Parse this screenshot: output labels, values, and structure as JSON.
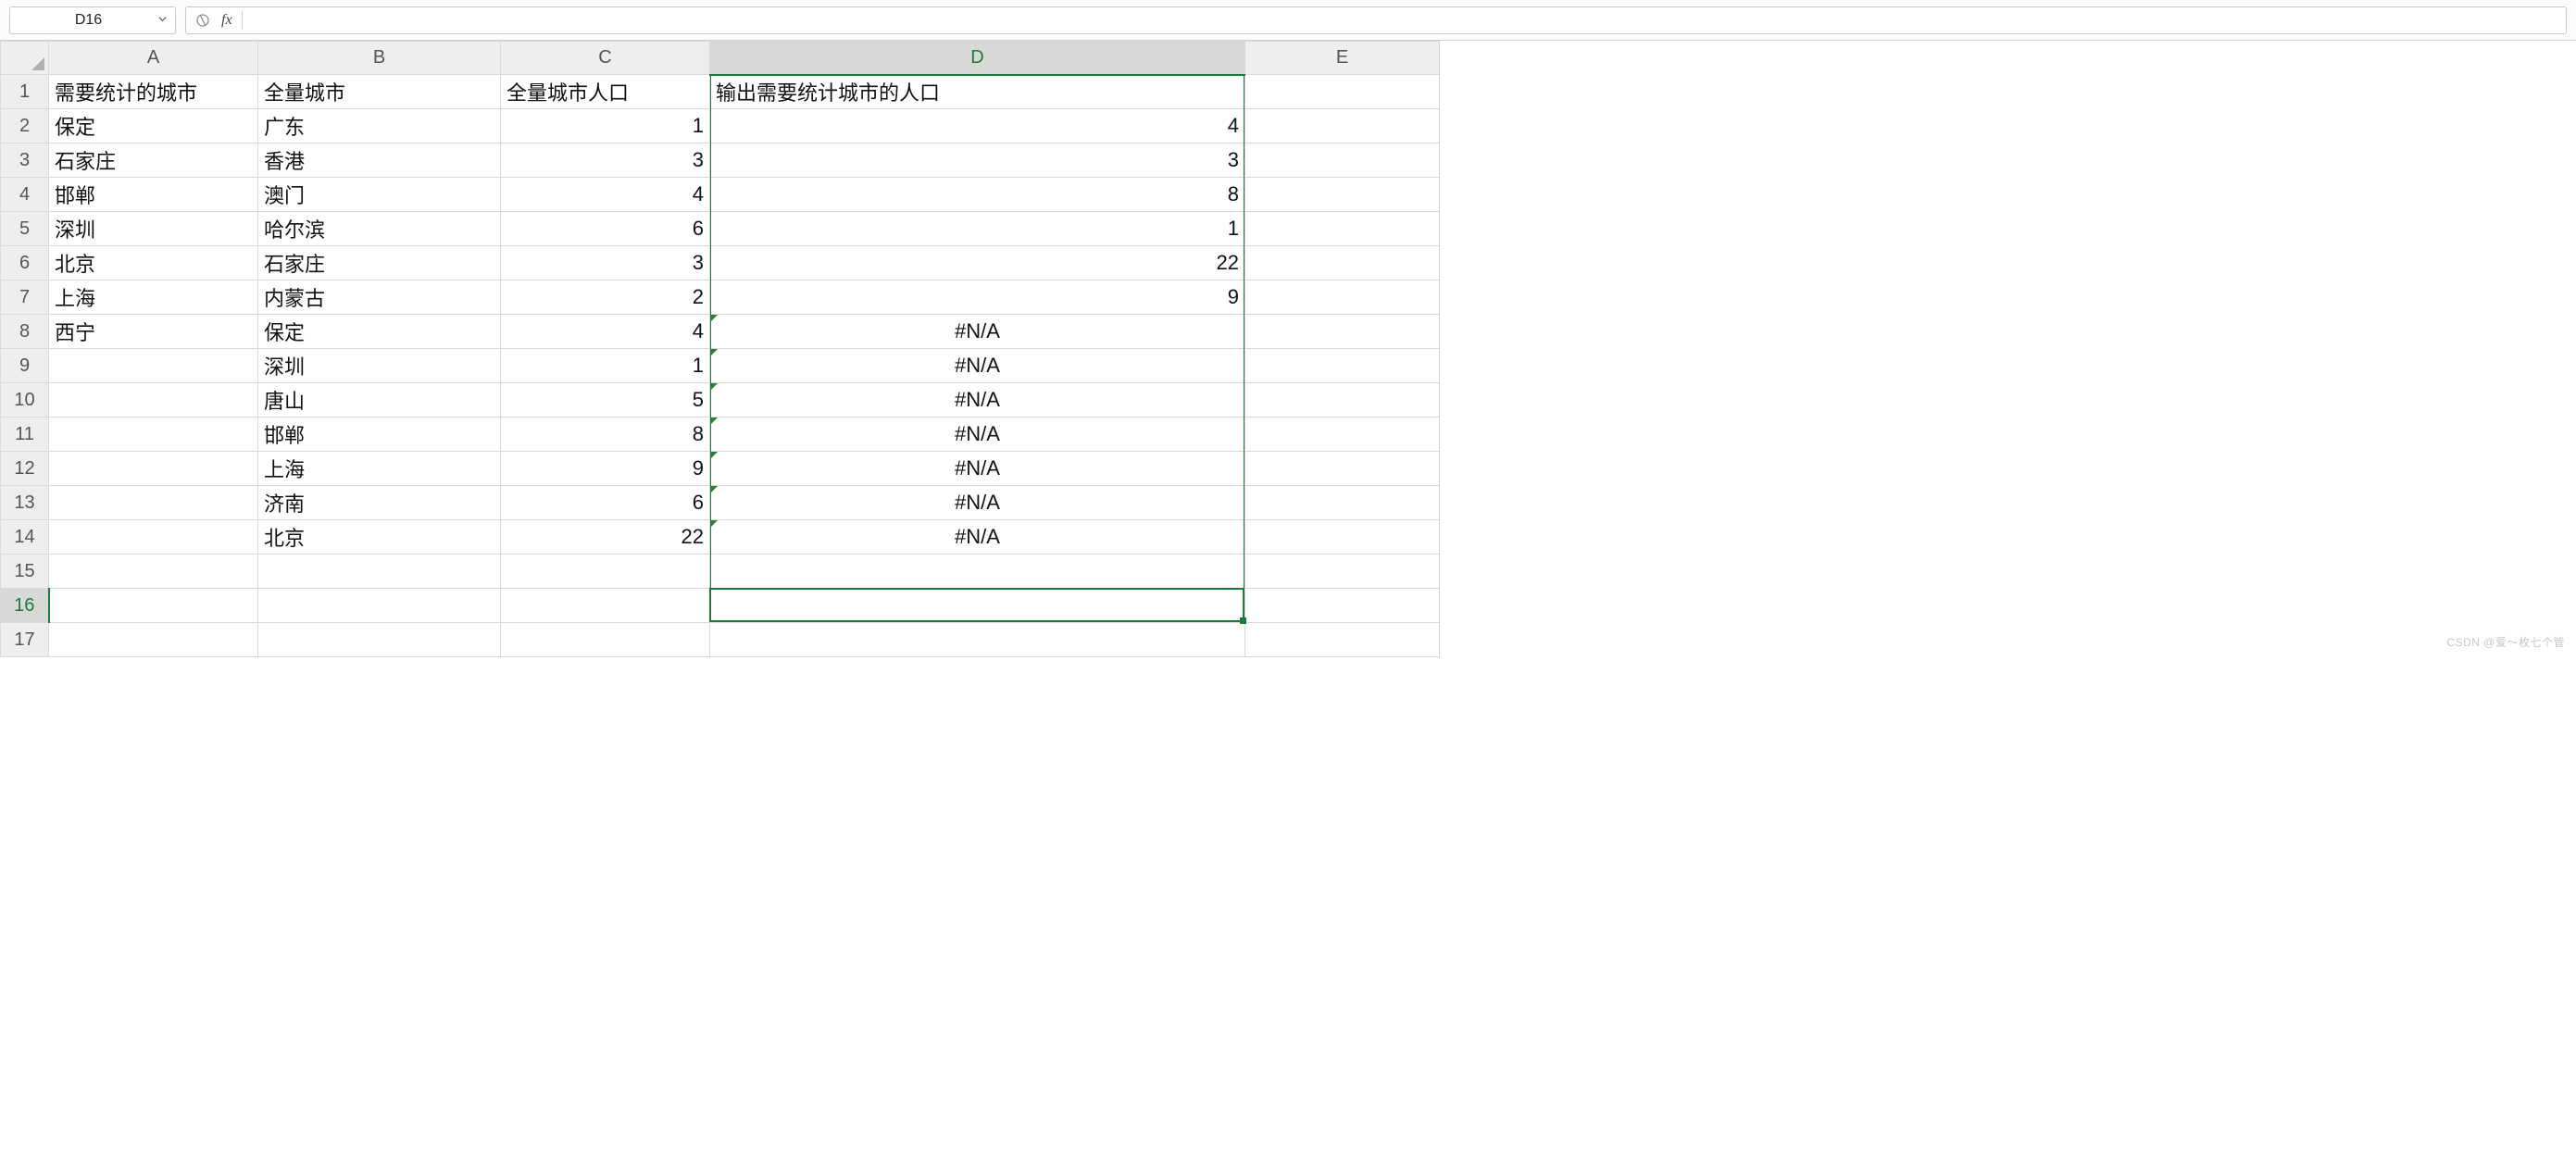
{
  "name_box": "D16",
  "formula_input": "",
  "fx_label": "fx",
  "columns": [
    "A",
    "B",
    "C",
    "D",
    "E"
  ],
  "col_classes": [
    "col-A",
    "col-B",
    "col-C",
    "col-D",
    "col-E"
  ],
  "active_col_index": 3,
  "active_row_index": 15,
  "row_count": 17,
  "rows": [
    {
      "n": 1,
      "cells": [
        {
          "v": "需要统计的城市",
          "a": "left"
        },
        {
          "v": "全量城市",
          "a": "left"
        },
        {
          "v": "全量城市人口",
          "a": "left"
        },
        {
          "v": "输出需要统计城市的人口",
          "a": "left"
        },
        {
          "v": "",
          "a": "left"
        }
      ]
    },
    {
      "n": 2,
      "cells": [
        {
          "v": "保定",
          "a": "left"
        },
        {
          "v": "广东",
          "a": "left"
        },
        {
          "v": "1",
          "a": "right"
        },
        {
          "v": "4",
          "a": "right"
        },
        {
          "v": "",
          "a": "left"
        }
      ]
    },
    {
      "n": 3,
      "cells": [
        {
          "v": "石家庄",
          "a": "left"
        },
        {
          "v": "香港",
          "a": "left"
        },
        {
          "v": "3",
          "a": "right"
        },
        {
          "v": "3",
          "a": "right"
        },
        {
          "v": "",
          "a": "left"
        }
      ]
    },
    {
      "n": 4,
      "cells": [
        {
          "v": "邯郸",
          "a": "left"
        },
        {
          "v": "澳门",
          "a": "left"
        },
        {
          "v": "4",
          "a": "right"
        },
        {
          "v": "8",
          "a": "right"
        },
        {
          "v": "",
          "a": "left"
        }
      ]
    },
    {
      "n": 5,
      "cells": [
        {
          "v": "深圳",
          "a": "left"
        },
        {
          "v": "哈尔滨",
          "a": "left"
        },
        {
          "v": "6",
          "a": "right"
        },
        {
          "v": "1",
          "a": "right"
        },
        {
          "v": "",
          "a": "left"
        }
      ]
    },
    {
      "n": 6,
      "cells": [
        {
          "v": "北京",
          "a": "left"
        },
        {
          "v": "石家庄",
          "a": "left"
        },
        {
          "v": "3",
          "a": "right"
        },
        {
          "v": "22",
          "a": "right"
        },
        {
          "v": "",
          "a": "left"
        }
      ]
    },
    {
      "n": 7,
      "cells": [
        {
          "v": "上海",
          "a": "left"
        },
        {
          "v": "内蒙古",
          "a": "left"
        },
        {
          "v": "2",
          "a": "right"
        },
        {
          "v": "9",
          "a": "right"
        },
        {
          "v": "",
          "a": "left"
        }
      ]
    },
    {
      "n": 8,
      "cells": [
        {
          "v": "西宁",
          "a": "left"
        },
        {
          "v": "保定",
          "a": "left"
        },
        {
          "v": "4",
          "a": "right"
        },
        {
          "v": "#N/A",
          "a": "center",
          "err": true
        },
        {
          "v": "",
          "a": "left"
        }
      ]
    },
    {
      "n": 9,
      "cells": [
        {
          "v": "",
          "a": "left"
        },
        {
          "v": "深圳",
          "a": "left"
        },
        {
          "v": "1",
          "a": "right"
        },
        {
          "v": "#N/A",
          "a": "center",
          "err": true
        },
        {
          "v": "",
          "a": "left"
        }
      ]
    },
    {
      "n": 10,
      "cells": [
        {
          "v": "",
          "a": "left"
        },
        {
          "v": "唐山",
          "a": "left"
        },
        {
          "v": "5",
          "a": "right"
        },
        {
          "v": "#N/A",
          "a": "center",
          "err": true
        },
        {
          "v": "",
          "a": "left"
        }
      ]
    },
    {
      "n": 11,
      "cells": [
        {
          "v": "",
          "a": "left"
        },
        {
          "v": "邯郸",
          "a": "left"
        },
        {
          "v": "8",
          "a": "right"
        },
        {
          "v": "#N/A",
          "a": "center",
          "err": true
        },
        {
          "v": "",
          "a": "left"
        }
      ]
    },
    {
      "n": 12,
      "cells": [
        {
          "v": "",
          "a": "left"
        },
        {
          "v": "上海",
          "a": "left"
        },
        {
          "v": "9",
          "a": "right"
        },
        {
          "v": "#N/A",
          "a": "center",
          "err": true
        },
        {
          "v": "",
          "a": "left"
        }
      ]
    },
    {
      "n": 13,
      "cells": [
        {
          "v": "",
          "a": "left"
        },
        {
          "v": "济南",
          "a": "left"
        },
        {
          "v": "6",
          "a": "right"
        },
        {
          "v": "#N/A",
          "a": "center",
          "err": true
        },
        {
          "v": "",
          "a": "left"
        }
      ]
    },
    {
      "n": 14,
      "cells": [
        {
          "v": "",
          "a": "left"
        },
        {
          "v": "北京",
          "a": "left"
        },
        {
          "v": "22",
          "a": "right"
        },
        {
          "v": "#N/A",
          "a": "center",
          "err": true
        },
        {
          "v": "",
          "a": "left"
        }
      ]
    },
    {
      "n": 15,
      "cells": [
        {
          "v": "",
          "a": "left"
        },
        {
          "v": "",
          "a": "left"
        },
        {
          "v": "",
          "a": "right"
        },
        {
          "v": "",
          "a": "right"
        },
        {
          "v": "",
          "a": "left"
        }
      ]
    },
    {
      "n": 16,
      "cells": [
        {
          "v": "",
          "a": "left"
        },
        {
          "v": "",
          "a": "left"
        },
        {
          "v": "",
          "a": "right"
        },
        {
          "v": "",
          "a": "right"
        },
        {
          "v": "",
          "a": "left"
        }
      ]
    },
    {
      "n": 17,
      "cells": [
        {
          "v": "",
          "a": "left"
        },
        {
          "v": "",
          "a": "left"
        },
        {
          "v": "",
          "a": "right"
        },
        {
          "v": "",
          "a": "right"
        },
        {
          "v": "",
          "a": "left"
        }
      ]
    }
  ],
  "watermark": "CSDN @爱～枚七个管"
}
